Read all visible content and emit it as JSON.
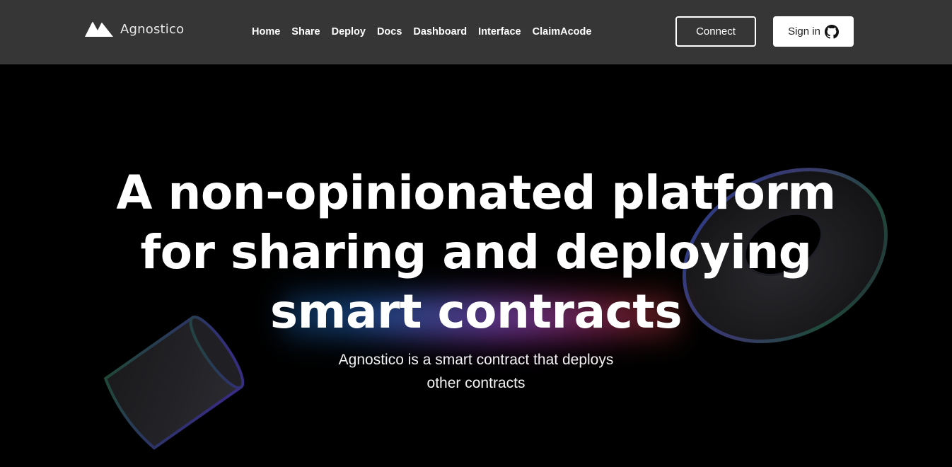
{
  "brand": {
    "name": "Agnostico"
  },
  "nav": {
    "items": [
      {
        "label": "Home"
      },
      {
        "label": "Share"
      },
      {
        "label": "Deploy"
      },
      {
        "label": "Docs"
      },
      {
        "label": "Dashboard"
      },
      {
        "label": "Interface"
      },
      {
        "label": "ClaimAcode"
      }
    ]
  },
  "actions": {
    "connect_label": "Connect",
    "signin_label": "Sign in",
    "signin_icon": "github-icon"
  },
  "hero": {
    "headline_lines": [
      "A non-opinionated platform",
      "for sharing and deploying",
      "smart contracts"
    ],
    "subtitle_lines": [
      "Agnostico is a smart contract that deploys",
      "other contracts"
    ]
  },
  "colors": {
    "navbar_bg": "#363636",
    "page_bg": "#000000",
    "text": "#ffffff"
  }
}
